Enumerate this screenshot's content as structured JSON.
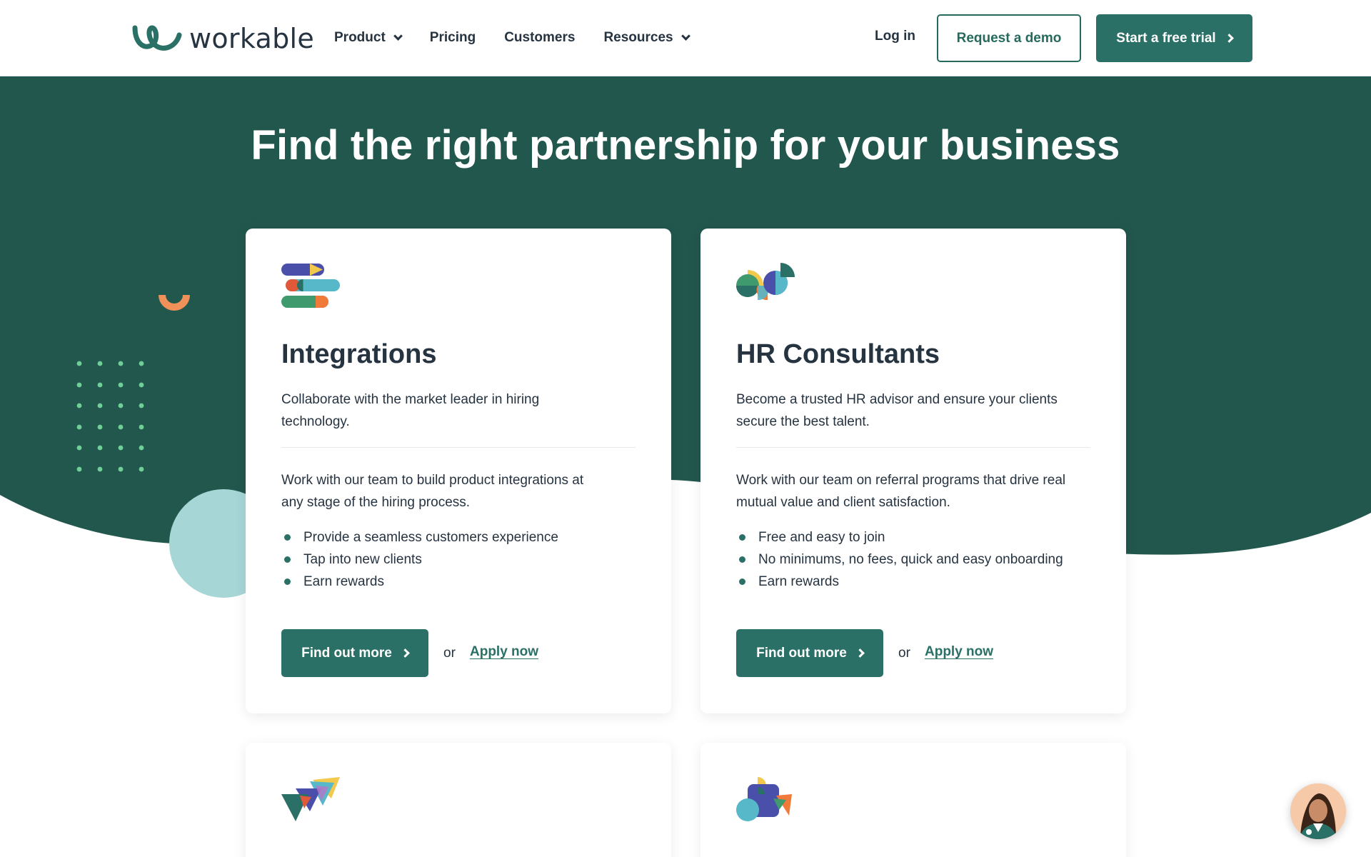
{
  "header": {
    "logo_text": "workable",
    "nav": [
      {
        "label": "Product",
        "has_dropdown": true
      },
      {
        "label": "Pricing",
        "has_dropdown": false
      },
      {
        "label": "Customers",
        "has_dropdown": false
      },
      {
        "label": "Resources",
        "has_dropdown": true
      }
    ],
    "login": "Log in",
    "demo": "Request a demo",
    "trial": "Start a free trial"
  },
  "hero": {
    "title": "Find the right partnership for your business"
  },
  "cards": [
    {
      "icon": "integrations-icon",
      "title": "Integrations",
      "subtitle": "Collaborate with the market leader in hiring technology.",
      "body": "Work with our team to build product integrations at any stage of the hiring process.",
      "bullets": [
        "Provide a seamless customers experience",
        "Tap into new clients",
        "Earn rewards"
      ],
      "cta": "Find out more",
      "or": "or",
      "apply": "Apply now"
    },
    {
      "icon": "hr-consultants-icon",
      "title": "HR Consultants",
      "subtitle": "Become a trusted HR advisor and ensure your clients secure the best talent.",
      "body": "Work with our team on referral programs that drive real mutual value and client satisfaction.",
      "bullets": [
        "Free and easy to join",
        "No minimums, no fees, quick and easy onboarding",
        "Earn rewards"
      ],
      "cta": "Find out more",
      "or": "or",
      "apply": "Apply now"
    },
    {
      "icon": "triangles-icon"
    },
    {
      "icon": "puzzle-icon"
    }
  ],
  "colors": {
    "brand_dark": "#22574d",
    "brand": "#2b7066",
    "text": "#263340",
    "accent_teal_light": "#a7d6d6",
    "accent_orange": "#f0915a",
    "accent_green_dots": "#6fcf97"
  },
  "chat_widget": {
    "icon": "chat-avatar-icon"
  }
}
